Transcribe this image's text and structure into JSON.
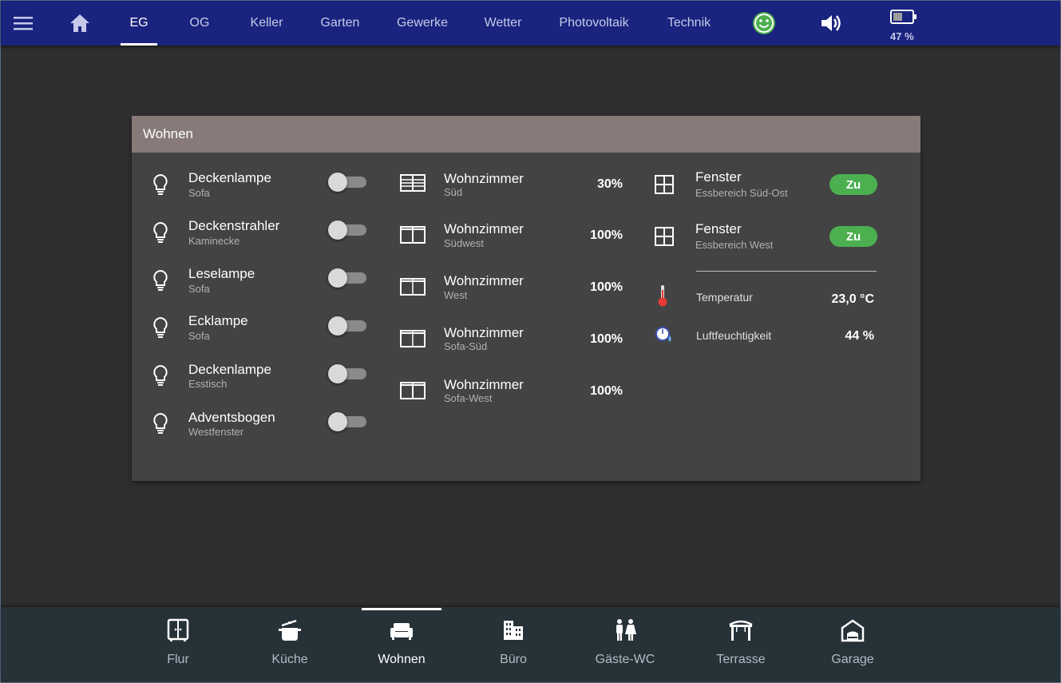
{
  "top_nav": {
    "tabs": [
      {
        "label": "EG",
        "active": true
      },
      {
        "label": "OG"
      },
      {
        "label": "Keller"
      },
      {
        "label": "Garten"
      },
      {
        "label": "Gewerke"
      },
      {
        "label": "Wetter"
      },
      {
        "label": "Photovoltaik"
      },
      {
        "label": "Technik"
      }
    ],
    "icons": [
      "menu-icon",
      "home-icon",
      "smiley-icon",
      "volume-icon",
      "battery-icon"
    ],
    "battery_level": "47 %",
    "accent_color": "#1a237e"
  },
  "card": {
    "title": "Wohnen",
    "header_color": "#877a78",
    "lights": [
      {
        "name": "Deckenlampe",
        "sub": "Sofa",
        "on": false
      },
      {
        "name": "Deckenstrahler",
        "sub": "Kaminecke",
        "on": false
      },
      {
        "name": "Leselampe",
        "sub": "Sofa",
        "on": false
      },
      {
        "name": "Ecklampe",
        "sub": "Sofa",
        "on": false
      },
      {
        "name": "Deckenlampe",
        "sub": "Esstisch",
        "on": false
      },
      {
        "name": "Adventsbogen",
        "sub": "Westfenster",
        "on": false
      }
    ],
    "shutters": [
      {
        "name": "Wohnzimmer",
        "sub": "Süd",
        "value": "30%"
      },
      {
        "name": "Wohnzimmer",
        "sub": "Südwest",
        "value": "100%"
      },
      {
        "name": "Wohnzimmer",
        "sub": "West",
        "value": "100%"
      },
      {
        "name": "Wohnzimmer",
        "sub": "Sofa-Süd",
        "value": "100%"
      },
      {
        "name": "Wohnzimmer",
        "sub": "Sofa-West",
        "value": "100%"
      }
    ],
    "windows": [
      {
        "name": "Fenster",
        "sub": "Essbereich Süd-Ost",
        "status": "Zu"
      },
      {
        "name": "Fenster",
        "sub": "Essbereich West",
        "status": "Zu"
      }
    ],
    "climate": {
      "temperature_label": "Temperatur",
      "temperature_value": "23,0 °C",
      "humidity_label": "Luftfeuchtigkeit",
      "humidity_value": "44 %"
    },
    "status_color": "#4caf50"
  },
  "bottom_nav": {
    "tabs": [
      {
        "label": "Flur",
        "icon": "wardrobe-icon"
      },
      {
        "label": "Küche",
        "icon": "cooking-pot-icon"
      },
      {
        "label": "Wohnen",
        "icon": "sofa-icon",
        "active": true
      },
      {
        "label": "Büro",
        "icon": "office-building-icon"
      },
      {
        "label": "Gäste-WC",
        "icon": "restroom-icon"
      },
      {
        "label": "Terrasse",
        "icon": "pergola-icon"
      },
      {
        "label": "Garage",
        "icon": "garage-icon"
      }
    ]
  }
}
